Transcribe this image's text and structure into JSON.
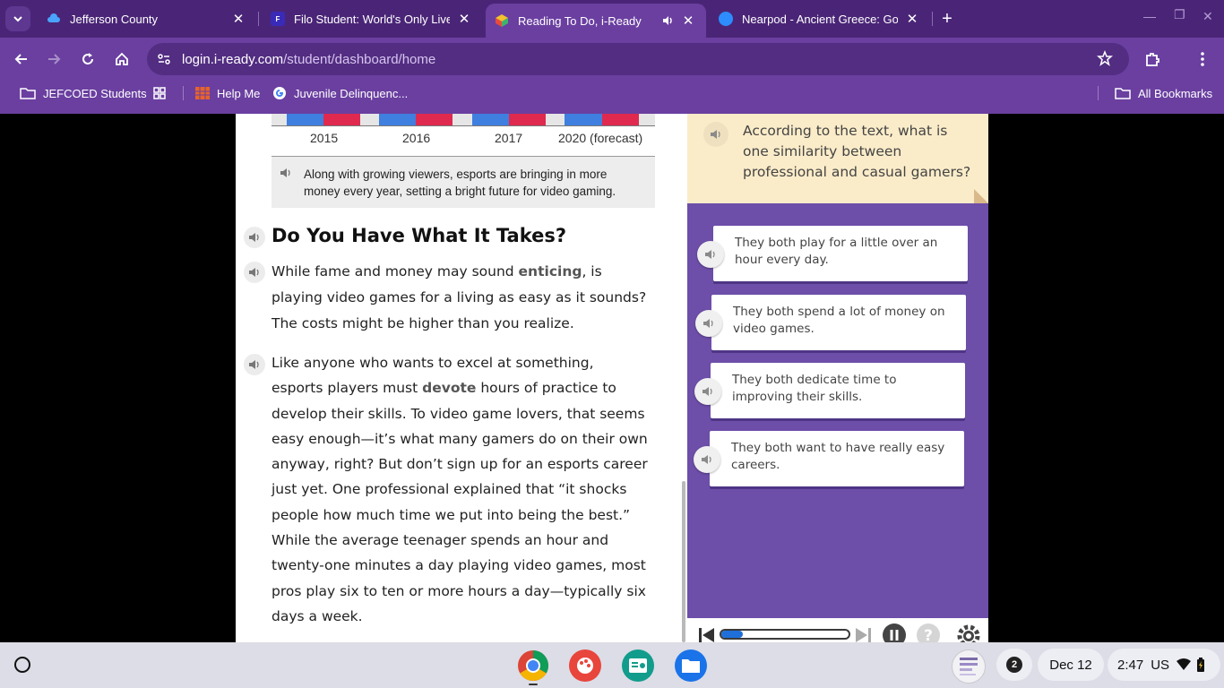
{
  "browser": {
    "tabs": [
      {
        "title": "Jefferson County",
        "active": false
      },
      {
        "title": "Filo Student: World's Only Live I",
        "active": false
      },
      {
        "title": "Reading To Do, i-Ready",
        "active": true
      },
      {
        "title": "Nearpod - Ancient Greece: Gods",
        "active": false
      }
    ],
    "url_host": "login.i-ready.com",
    "url_path": "/student/dashboard/home",
    "bookmarks": [
      {
        "label": "JEFCOED Students"
      },
      {
        "label": ""
      },
      {
        "label": "Help Me"
      },
      {
        "label": "Juvenile Delinquenc..."
      }
    ],
    "all_bookmarks": "All Bookmarks"
  },
  "reader": {
    "chart_ticks": [
      "2015",
      "2016",
      "2017",
      "2020 (forecast)"
    ],
    "caption": "Along with growing viewers, esports are bringing in more money every year, setting a bright future for video gaming.",
    "heading": "Do You Have What It Takes?",
    "para1": {
      "before": "While fame and money may sound ",
      "vocab": "enticing",
      "after": ", is playing video games for a living as easy as it sounds? The costs might be higher than you realize."
    },
    "para2": {
      "before": "Like anyone who wants to excel at something, esports players must ",
      "vocab": "devote",
      "after": " hours of practice to develop their skills. To video game lovers, that seems easy enough—it’s what many gamers do on their own anyway, right? But don’t sign up for an esports career just yet. One professional explained that “it shocks people how much time we put into being the best.” While the average teenager spends an hour and twenty-one minutes a day playing video games, most pros play six to ten or more hours a day—typically six days a week."
    }
  },
  "question": {
    "prompt": "According to the text, what is one similarity between professional and casual gamers?",
    "answers": [
      "They both play for a little over an hour every day.",
      "They both spend a lot of money on video games.",
      "They both dedicate time to improving their skills.",
      "They both want to have really easy careers."
    ],
    "audio_progress": 0.17
  },
  "shelf": {
    "notification_count": "2",
    "date": "Dec 12",
    "time": "2:47",
    "locale": "US"
  },
  "colors": {
    "frame": "#4a2577",
    "toolbar": "#6a3fa0",
    "panel": "#6d4ea9",
    "question_card": "#fbecc9",
    "bar_blue": "#3f7fe0",
    "bar_red": "#e0294e"
  }
}
